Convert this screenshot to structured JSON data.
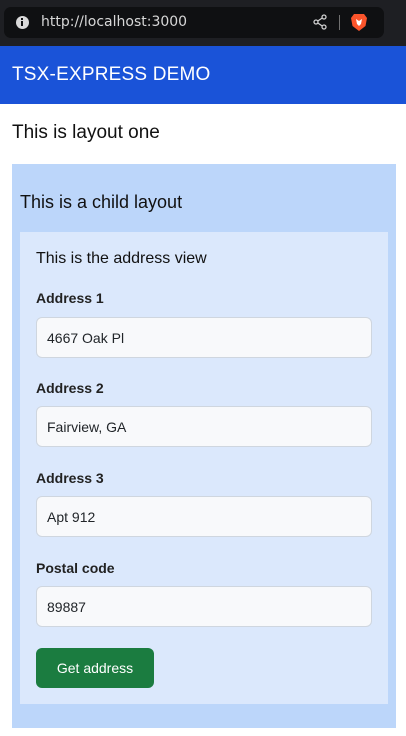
{
  "browser": {
    "url": "http://localhost:3000",
    "icons": {
      "info": "info-icon",
      "share": "share-icon",
      "brave": "brave-lion-icon"
    }
  },
  "header": {
    "title": "TSX-EXPRESS DEMO"
  },
  "layout_one": {
    "title": "This is layout one"
  },
  "child_layout": {
    "title": "This is a child layout"
  },
  "address_view": {
    "title": "This is the address view",
    "fields": [
      {
        "label": "Address 1",
        "value": "4667 Oak Pl"
      },
      {
        "label": "Address 2",
        "value": "Fairview, GA"
      },
      {
        "label": "Address 3",
        "value": "Apt 912"
      },
      {
        "label": "Postal code",
        "value": "89887"
      }
    ],
    "button_label": "Get address"
  },
  "colors": {
    "header_bg": "#1a53d8",
    "child_layout_bg": "#bcd6fa",
    "address_view_bg": "#dbe8fc",
    "button_bg": "#1b7c40",
    "brave_orange": "#fb542b"
  }
}
